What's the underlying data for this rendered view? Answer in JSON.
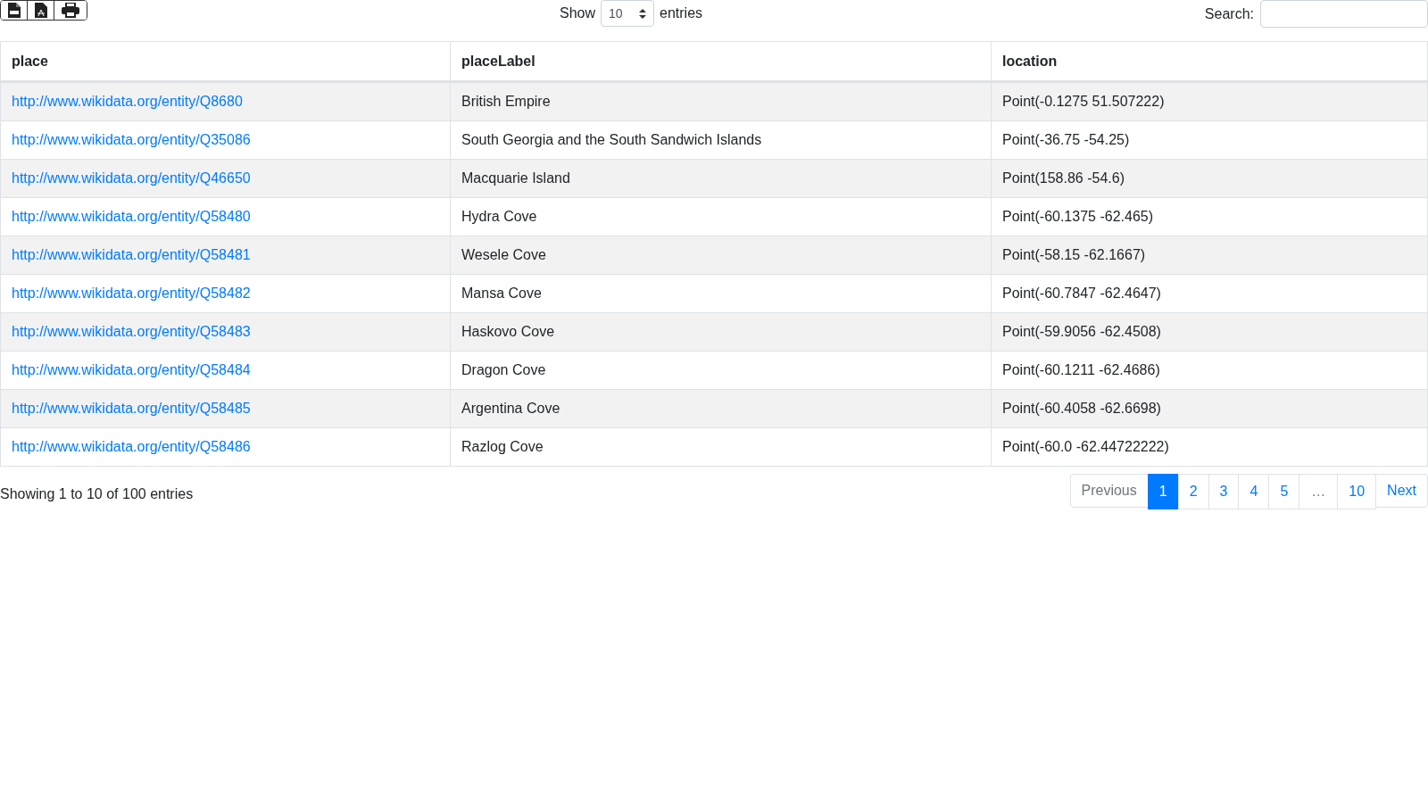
{
  "toolbar": {
    "export_buttons": [
      {
        "kind": "csv"
      },
      {
        "kind": "pdf"
      },
      {
        "kind": "print"
      }
    ],
    "length": {
      "before": "Show",
      "value": "10",
      "after": "entries"
    },
    "search": {
      "label": "Search:"
    }
  },
  "table": {
    "columns": [
      "place",
      "placeLabel",
      "location"
    ],
    "rows": [
      [
        "http://www.wikidata.org/entity/Q8680",
        "British Empire",
        "Point(-0.1275 51.507222)"
      ],
      [
        "http://www.wikidata.org/entity/Q35086",
        "South Georgia and the South Sandwich Islands",
        "Point(-36.75 -54.25)"
      ],
      [
        "http://www.wikidata.org/entity/Q46650",
        "Macquarie Island",
        "Point(158.86 -54.6)"
      ],
      [
        "http://www.wikidata.org/entity/Q58480",
        "Hydra Cove",
        "Point(-60.1375 -62.465)"
      ],
      [
        "http://www.wikidata.org/entity/Q58481",
        "Wesele Cove",
        "Point(-58.15 -62.1667)"
      ],
      [
        "http://www.wikidata.org/entity/Q58482",
        "Mansa Cove",
        "Point(-60.7847 -62.4647)"
      ],
      [
        "http://www.wikidata.org/entity/Q58483",
        "Haskovo Cove",
        "Point(-59.9056 -62.4508)"
      ],
      [
        "http://www.wikidata.org/entity/Q58484",
        "Dragon Cove",
        "Point(-60.1211 -62.4686)"
      ],
      [
        "http://www.wikidata.org/entity/Q58485",
        "Argentina Cove",
        "Point(-60.4058 -62.6698)"
      ],
      [
        "http://www.wikidata.org/entity/Q58486",
        "Razlog Cove",
        "Point(-60.0 -62.44722222)"
      ]
    ]
  },
  "info": "Showing 1 to 10 of 100 entries",
  "pagination": [
    {
      "kind": "nav",
      "label": "Previous",
      "selected": false,
      "disabled": true
    },
    {
      "kind": "page",
      "label": "1",
      "selected": true,
      "disabled": false
    },
    {
      "kind": "page",
      "label": "2",
      "selected": false,
      "disabled": false
    },
    {
      "kind": "page",
      "label": "3",
      "selected": false,
      "disabled": false
    },
    {
      "kind": "page",
      "label": "4",
      "selected": false,
      "disabled": false
    },
    {
      "kind": "page",
      "label": "5",
      "selected": false,
      "disabled": false
    },
    {
      "kind": "ellipsis",
      "label": "…",
      "selected": false,
      "disabled": true
    },
    {
      "kind": "page",
      "label": "10",
      "selected": false,
      "disabled": false
    },
    {
      "kind": "nav",
      "label": "Next",
      "selected": false,
      "disabled": false
    }
  ]
}
